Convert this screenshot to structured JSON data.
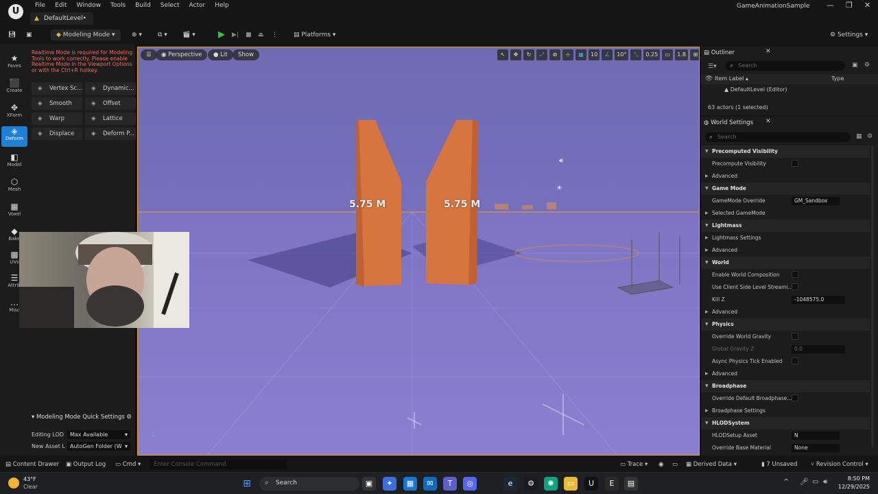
{
  "titlebar": {
    "menu": [
      "File",
      "Edit",
      "Window",
      "Tools",
      "Build",
      "Select",
      "Actor",
      "Help"
    ],
    "level_tab": "DefaultLevel•",
    "window_title": "GameAnimationSample",
    "controls": [
      "—",
      "❐",
      "✕"
    ]
  },
  "toolbar": {
    "mode_label": "Modeling Mode",
    "platforms_label": "Platforms",
    "settings_label": "Settings"
  },
  "leftbar": {
    "items": [
      {
        "label": "Faves",
        "icon": "star-icon",
        "glyph": "★"
      },
      {
        "label": "Create",
        "icon": "cube-icon",
        "glyph": "⬛"
      },
      {
        "label": "XForm",
        "icon": "move-icon",
        "glyph": "✥"
      },
      {
        "label": "Deform",
        "icon": "deform-icon",
        "glyph": "◈"
      },
      {
        "label": "Model",
        "icon": "model-icon",
        "glyph": "◧"
      },
      {
        "label": "Mesh",
        "icon": "mesh-icon",
        "glyph": "⬡"
      },
      {
        "label": "Voxel",
        "icon": "voxel-icon",
        "glyph": "▦"
      },
      {
        "label": "Bake",
        "icon": "bake-icon",
        "glyph": "◆"
      },
      {
        "label": "UVs",
        "icon": "uv-icon",
        "glyph": "▩"
      },
      {
        "label": "Attrib",
        "icon": "attrib-icon",
        "glyph": "☰"
      },
      {
        "label": "Misc",
        "icon": "misc-icon",
        "glyph": "…"
      }
    ]
  },
  "modepanel": {
    "warning": "Realtime Mode is required for Modeling Tools to work correctly. Please enable Realtime Mode in the Viewport Options or with the Ctrl+R hotkey.",
    "tools": [
      "Vertex Sc...",
      "Dynamic...",
      "Smooth",
      "Offset",
      "Warp",
      "Lattice",
      "Displace",
      "Deform P..."
    ],
    "quick_settings_title": "Modeling Mode Quick Settings",
    "editing_lod_label": "Editing LOD",
    "editing_lod_value": "Max Available",
    "new_asset_label": "New Asset L",
    "new_asset_value": "AutoGen Folder (W"
  },
  "viewport": {
    "perspective": "Perspective",
    "lit": "Lit",
    "show": "Show",
    "grid_value": "10",
    "angle_value": "10°",
    "scale_value": "0.25",
    "cam_speed": "1.8",
    "measure_left": "5.75 M",
    "measure_right": "5.75 M"
  },
  "outliner": {
    "title": "Outliner",
    "search_placeholder": "Search",
    "col_label": "Item Label ▴",
    "col_type": "Type",
    "root_item": "DefaultLevel (Editor)",
    "status": "63 actors (1 selected)"
  },
  "worldsettings": {
    "title": "World Settings",
    "search_placeholder": "Search",
    "rows": [
      {
        "kind": "cat",
        "label": "Precomputed Visibility"
      },
      {
        "kind": "prop",
        "label": "Precompute Visibility",
        "control": "checkbox"
      },
      {
        "kind": "sub",
        "label": "Advanced"
      },
      {
        "kind": "cat",
        "label": "Game Mode"
      },
      {
        "kind": "prop",
        "label": "GameMode Override",
        "control": "select",
        "value": "GM_Sandbox"
      },
      {
        "kind": "sub",
        "label": "Selected GameMode"
      },
      {
        "kind": "cat",
        "label": "Lightmass"
      },
      {
        "kind": "sub",
        "label": "Lightmass Settings"
      },
      {
        "kind": "sub",
        "label": "Advanced"
      },
      {
        "kind": "cat",
        "label": "World"
      },
      {
        "kind": "prop",
        "label": "Enable World Composition",
        "control": "checkbox"
      },
      {
        "kind": "prop",
        "label": "Use Client Side Level Streami...",
        "control": "checkbox"
      },
      {
        "kind": "prop",
        "label": "Kill Z",
        "control": "field",
        "value": "-1048575.0"
      },
      {
        "kind": "sub",
        "label": "Advanced"
      },
      {
        "kind": "cat",
        "label": "Physics"
      },
      {
        "kind": "prop",
        "label": "Override World Gravity",
        "control": "checkbox"
      },
      {
        "kind": "prop",
        "label": "Global Gravity Z",
        "control": "field",
        "value": "0.0",
        "disabled": true
      },
      {
        "kind": "prop",
        "label": "Async Physics Tick Enabled",
        "control": "checkbox"
      },
      {
        "kind": "sub",
        "label": "Advanced"
      },
      {
        "kind": "cat",
        "label": "Broadphase"
      },
      {
        "kind": "prop",
        "label": "Override Default Broadphase...",
        "control": "checkbox"
      },
      {
        "kind": "sub",
        "label": "Broadphase Settings"
      },
      {
        "kind": "cat",
        "label": "HLODSystem"
      },
      {
        "kind": "prop",
        "label": "HLODSetup Asset",
        "control": "select",
        "value": "N"
      },
      {
        "kind": "prop",
        "label": "Override Base Material",
        "control": "select",
        "value": "None"
      }
    ]
  },
  "bottombar": {
    "content_drawer": "Content Drawer",
    "output_log": "Output Log",
    "cmd": "Cmd",
    "console_placeholder": "Enter Console Command",
    "trace": "Trace",
    "derived_data": "Derived Data",
    "unsaved": "7 Unsaved",
    "revision_control": "Revision Control"
  },
  "taskbar": {
    "weather_temp": "43°F",
    "weather_desc": "Clear",
    "search_label": "Search",
    "time": "8:50 PM",
    "date": "12/29/2025"
  }
}
